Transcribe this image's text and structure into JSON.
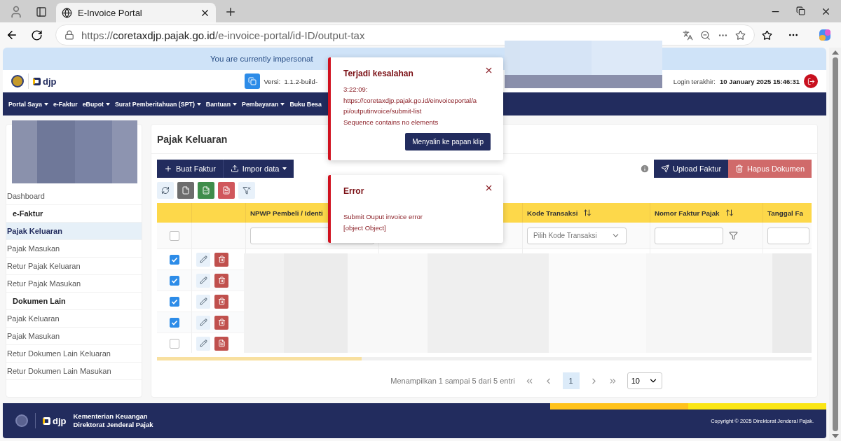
{
  "browser": {
    "tab_title": "E-Invoice Portal",
    "url_scheme": "https://",
    "url_host": "coretaxdjp.pajak.go.id",
    "url_path": "/e-invoice-portal/id-ID/output-tax"
  },
  "banner": "You are currently impersonat",
  "header": {
    "logo_text": "djp",
    "version": "Versi:  1.1.2-build-",
    "login_label": "Login terakhir:",
    "login_value": "10 January 2025 15:46:31"
  },
  "nav": [
    {
      "label": "Portal Saya",
      "dropdown": true
    },
    {
      "label": "e-Faktur",
      "dropdown": false
    },
    {
      "label": "eBupot",
      "dropdown": true
    },
    {
      "label": "Surat Pemberitahuan (SPT)",
      "dropdown": true
    },
    {
      "label": "Bantuan",
      "dropdown": true
    },
    {
      "label": "Pembayaran",
      "dropdown": true
    },
    {
      "label": "Buku Besa",
      "dropdown": false
    }
  ],
  "sidebar": {
    "items": [
      {
        "label": "Dashboard",
        "kind": "link",
        "selected": false
      },
      {
        "label": "e-Faktur",
        "kind": "heading"
      },
      {
        "label": "Pajak Keluaran",
        "kind": "link",
        "selected": true
      },
      {
        "label": "Pajak Masukan",
        "kind": "link",
        "selected": false
      },
      {
        "label": "Retur Pajak Keluaran",
        "kind": "link",
        "selected": false
      },
      {
        "label": "Retur Pajak Masukan",
        "kind": "link",
        "selected": false
      },
      {
        "label": "Dokumen Lain",
        "kind": "heading"
      },
      {
        "label": "Pajak Keluaran",
        "kind": "link",
        "selected": false
      },
      {
        "label": "Pajak Masukan",
        "kind": "link",
        "selected": false
      },
      {
        "label": "Retur Dokumen Lain Keluaran",
        "kind": "link",
        "selected": false
      },
      {
        "label": "Retur Dokumen Lain Masukan",
        "kind": "link",
        "selected": false
      }
    ]
  },
  "page": {
    "title": "Pajak Keluaran",
    "create_button": "Buat Faktur",
    "import_button": "Impor data",
    "upload_button": "Upload Faktur",
    "delete_button": "Hapus Dokumen"
  },
  "table": {
    "columns": [
      {
        "kind": "select"
      },
      {
        "kind": "actions"
      },
      {
        "kind": "text",
        "label": "NPWP Pembeli / Identi",
        "filter": {
          "kind": "input"
        }
      },
      {
        "kind": "text"
      },
      {
        "kind": "text",
        "label": "Kode Transaksi",
        "sortable": true,
        "filter": {
          "kind": "select",
          "placeholder": "Pilih Kode Transaksi"
        }
      },
      {
        "kind": "text",
        "label": "Nomor Faktur Pajak",
        "sortable": true,
        "filter": {
          "kind": "input_icon"
        }
      },
      {
        "kind": "text",
        "label": "Tanggal Fa",
        "filter": {
          "kind": "input"
        }
      }
    ],
    "select_all_checked": false,
    "rows": [
      {
        "checked": true,
        "kind": "delete"
      },
      {
        "checked": true,
        "kind": "delete"
      },
      {
        "checked": true,
        "kind": "delete"
      },
      {
        "checked": true,
        "kind": "delete"
      },
      {
        "checked": false,
        "kind": "pdf"
      }
    ]
  },
  "pagination": {
    "summary": "Menampilkan 1 sampai 5 dari 5 entri",
    "pages": [
      {
        "label": "1",
        "selected": true
      }
    ],
    "page_size": "10"
  },
  "toasts": [
    {
      "title": "Terjadi kesalahan",
      "lines": [
        "3:22:09:",
        "https://coretaxdjp.pajak.go.id/einvoiceportal/a",
        "pi/outputinvoice/submit-list",
        "Sequence contains no elements"
      ],
      "button": "Menyalin ke papan klip"
    },
    {
      "title": "Error",
      "lines": [
        "Submit Ouput invoice error",
        "[object Object]"
      ]
    }
  ],
  "footer": {
    "logo_text": "djp",
    "org_lines": [
      "Kementerian Keuangan",
      "Direktorat Jenderal Pajak"
    ],
    "copyright": "Copyright © 2025 Direktorat Jenderal Pajak."
  }
}
